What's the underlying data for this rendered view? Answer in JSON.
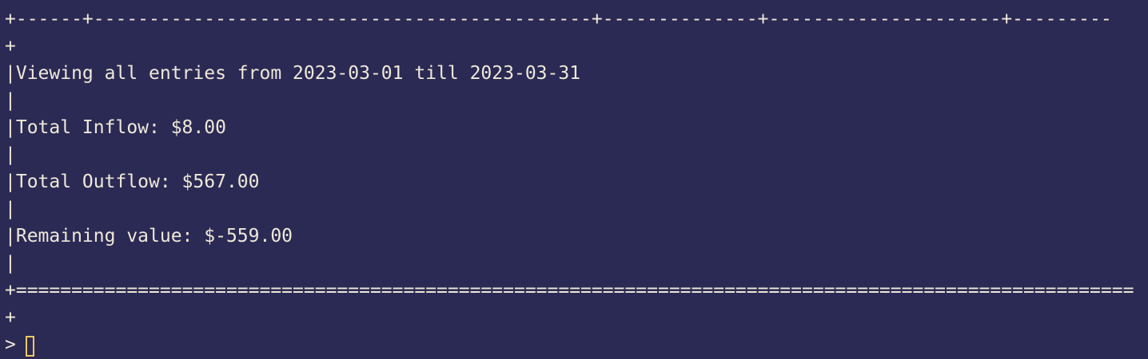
{
  "terminal": {
    "lines": [
      "+------+---------------------------------------------+--------------+---------------------+---------",
      "+",
      "|Viewing all entries from 2023-03-01 till 2023-03-31",
      "|",
      "|Total Inflow: $8.00",
      "|",
      "|Total Outflow: $567.00",
      "|",
      "|Remaining value: $-559.00",
      "|",
      "+=====================================================================================================",
      "+"
    ],
    "prompt": ">",
    "cursor_color": "#f3c85f",
    "background_color": "#2b2a55",
    "text_color": "#efe8d8"
  }
}
